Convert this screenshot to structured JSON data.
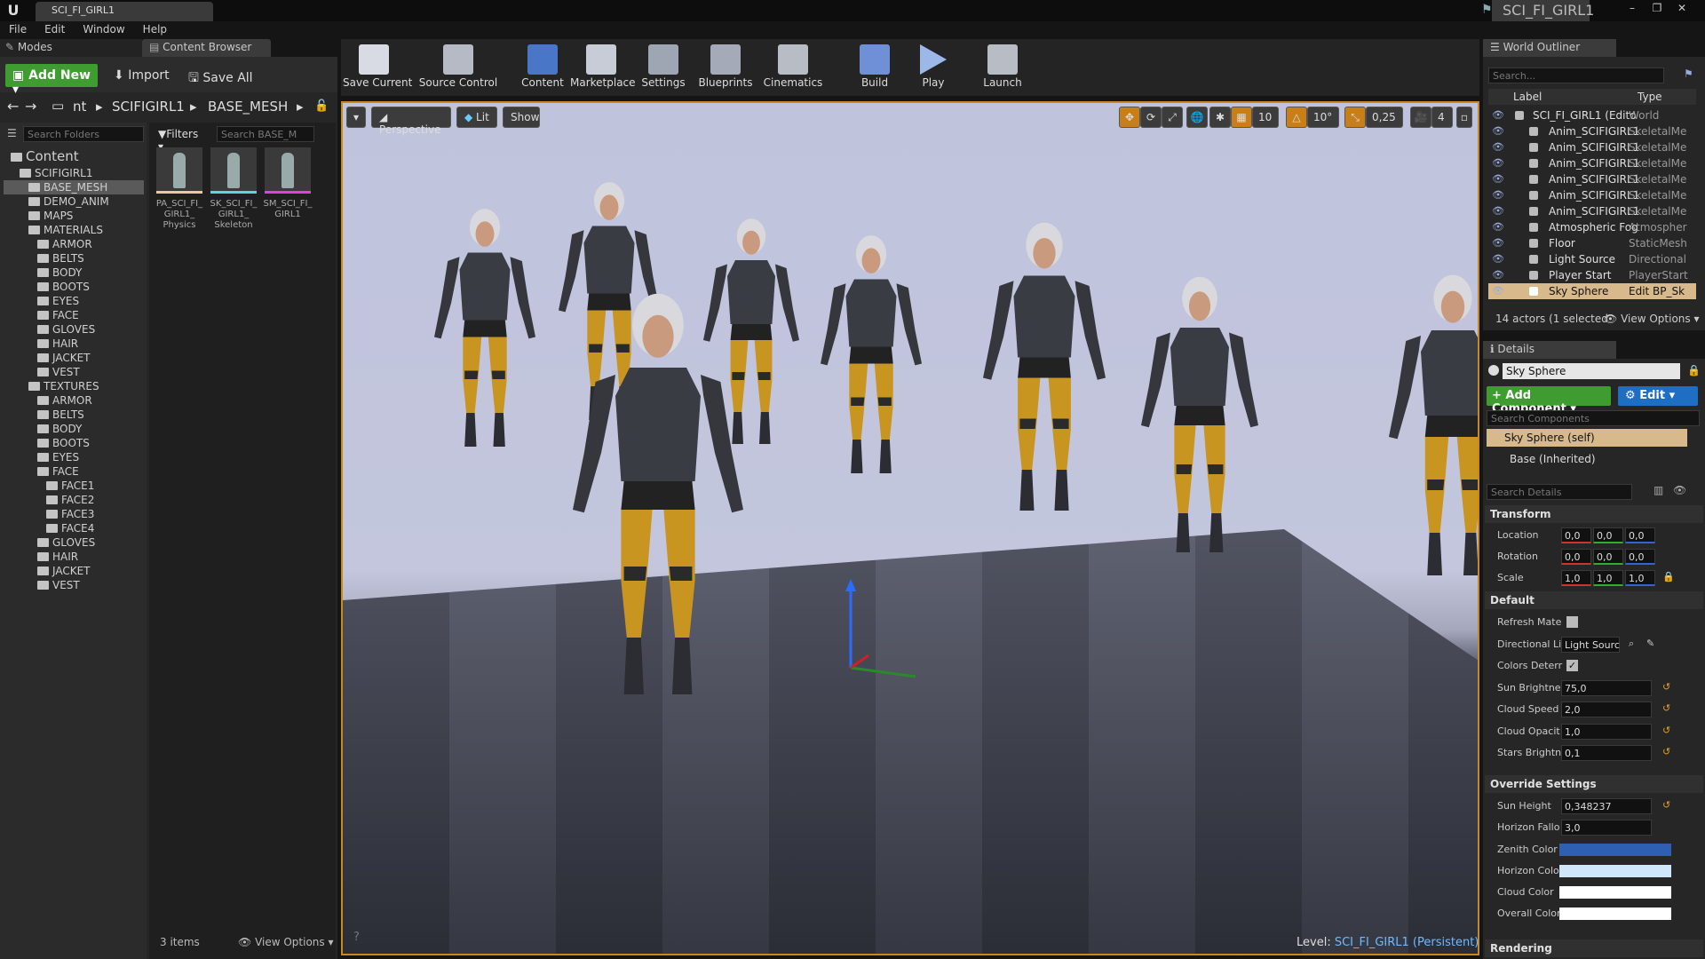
{
  "window": {
    "tab": "SCI_FI_GIRL1",
    "title": "SCI_FI_GIRL1"
  },
  "menu": [
    "File",
    "Edit",
    "Window",
    "Help"
  ],
  "panels": {
    "modes": "Modes",
    "content_browser": "Content Browser",
    "world_outliner": "World Outliner",
    "details": "Details"
  },
  "cb": {
    "add_new": "Add New",
    "import": "Import",
    "save_all": "Save All",
    "path": [
      "nt",
      "SCIFIGIRL1",
      "BASE_MESH"
    ],
    "folder_search": "Search Folders",
    "filters": "Filters",
    "asset_search": "Search BASE_M",
    "tree": [
      {
        "label": "Content",
        "depth": 0
      },
      {
        "label": "SCIFIGIRL1",
        "depth": 1
      },
      {
        "label": "BASE_MESH",
        "depth": 2,
        "selected": true
      },
      {
        "label": "DEMO_ANIM",
        "depth": 2
      },
      {
        "label": "MAPS",
        "depth": 2
      },
      {
        "label": "MATERIALS",
        "depth": 2
      },
      {
        "label": "ARMOR",
        "depth": 3
      },
      {
        "label": "BELTS",
        "depth": 3
      },
      {
        "label": "BODY",
        "depth": 3
      },
      {
        "label": "BOOTS",
        "depth": 3
      },
      {
        "label": "EYES",
        "depth": 3
      },
      {
        "label": "FACE",
        "depth": 3
      },
      {
        "label": "GLOVES",
        "depth": 3
      },
      {
        "label": "HAIR",
        "depth": 3
      },
      {
        "label": "JACKET",
        "depth": 3
      },
      {
        "label": "VEST",
        "depth": 3
      },
      {
        "label": "TEXTURES",
        "depth": 2
      },
      {
        "label": "ARMOR",
        "depth": 3
      },
      {
        "label": "BELTS",
        "depth": 3
      },
      {
        "label": "BODY",
        "depth": 3
      },
      {
        "label": "BOOTS",
        "depth": 3
      },
      {
        "label": "EYES",
        "depth": 3
      },
      {
        "label": "FACE",
        "depth": 3
      },
      {
        "label": "FACE1",
        "depth": 4
      },
      {
        "label": "FACE2",
        "depth": 4
      },
      {
        "label": "FACE3",
        "depth": 4
      },
      {
        "label": "FACE4",
        "depth": 4
      },
      {
        "label": "GLOVES",
        "depth": 3
      },
      {
        "label": "HAIR",
        "depth": 3
      },
      {
        "label": "JACKET",
        "depth": 3
      },
      {
        "label": "VEST",
        "depth": 3
      }
    ],
    "assets": [
      {
        "line1": "PA_SCI_FI_",
        "line2": "GIRL1_",
        "line3": "Physics",
        "color": "#e8c9a0"
      },
      {
        "line1": "SK_SCI_FI_",
        "line2": "GIRL1_",
        "line3": "Skeleton",
        "color": "#5fd3e0"
      },
      {
        "line1": "SM_SCI_FI_",
        "line2": "GIRL1",
        "line3": "",
        "color": "#e040e0"
      }
    ],
    "items_count": "3 items",
    "view_options": "View Options"
  },
  "toolbar": [
    {
      "label": "Save Current",
      "icon": "save-icon"
    },
    {
      "label": "Source Control",
      "icon": "source-control-icon"
    },
    {
      "label": "Content",
      "icon": "content-icon"
    },
    {
      "label": "Marketplace",
      "icon": "marketplace-icon"
    },
    {
      "label": "Settings",
      "icon": "settings-icon"
    },
    {
      "label": "Blueprints",
      "icon": "blueprints-icon"
    },
    {
      "label": "Cinematics",
      "icon": "cinematics-icon"
    },
    {
      "label": "Build",
      "icon": "build-icon"
    },
    {
      "label": "Play",
      "icon": "play-icon"
    },
    {
      "label": "Launch",
      "icon": "launch-icon"
    }
  ],
  "viewport": {
    "perspective": "Perspective",
    "lit": "Lit",
    "show": "Show",
    "grid_snap": "10",
    "rot_snap": "10°",
    "scale_snap": "0,25",
    "cam_speed": "4",
    "level_label": "Level:",
    "level_name": "SCI_FI_GIRL1 (Persistent)"
  },
  "outliner": {
    "search": "Search...",
    "col_label": "Label",
    "col_type": "Type",
    "rows": [
      {
        "label": "SCI_FI_GIRL1 (Edito",
        "type": "World"
      },
      {
        "label": "Anim_SCIFIGIRL1",
        "type": "SkeletalMe"
      },
      {
        "label": "Anim_SCIFIGIRL1",
        "type": "SkeletalMe"
      },
      {
        "label": "Anim_SCIFIGIRL1",
        "type": "SkeletalMe"
      },
      {
        "label": "Anim_SCIFIGIRL1",
        "type": "SkeletalMe"
      },
      {
        "label": "Anim_SCIFIGIRL1",
        "type": "SkeletalMe"
      },
      {
        "label": "Anim_SCIFIGIRL1",
        "type": "SkeletalMe"
      },
      {
        "label": "Atmospheric Fog",
        "type": "Atmospher"
      },
      {
        "label": "Floor",
        "type": "StaticMesh"
      },
      {
        "label": "Light Source",
        "type": "Directional"
      },
      {
        "label": "Player Start",
        "type": "PlayerStart"
      },
      {
        "label": "Sky Sphere",
        "type": "Edit BP_Sk",
        "selected": true
      }
    ],
    "status": "14 actors (1 selected",
    "view_options": "View Options"
  },
  "details": {
    "name": "Sky Sphere",
    "add_component": "+ Add Component",
    "edit_bp": "Edit",
    "search_components": "Search Components",
    "self": "Sky Sphere (self)",
    "base": "Base (Inherited)",
    "search_details": "Search Details",
    "transform": "Transform",
    "location": {
      "label": "Location",
      "x": "0,0",
      "y": "0,0",
      "z": "0,0"
    },
    "rotation": {
      "label": "Rotation",
      "x": "0,0",
      "y": "0,0",
      "z": "0,0"
    },
    "scale": {
      "label": "Scale",
      "x": "1,0",
      "y": "1,0",
      "z": "1,0"
    },
    "default": "Default",
    "props": [
      {
        "label": "Refresh Mate",
        "kind": "check",
        "checked": false
      },
      {
        "label": "Directional Li",
        "kind": "select",
        "value": "Light Sourc"
      },
      {
        "label": "Colors Deterr",
        "kind": "check",
        "checked": true
      },
      {
        "label": "Sun Brightne",
        "kind": "num",
        "value": "75,0"
      },
      {
        "label": "Cloud Speed",
        "kind": "num",
        "value": "2,0"
      },
      {
        "label": "Cloud Opacit",
        "kind": "num",
        "value": "1,0"
      },
      {
        "label": "Stars Brightn",
        "kind": "num",
        "value": "0,1"
      }
    ],
    "override": "Override Settings",
    "override_props": [
      {
        "label": "Sun Height",
        "value": "0,348237"
      },
      {
        "label": "Horizon Fallo",
        "value": "3,0"
      }
    ],
    "colors": [
      {
        "label": "Zenith Color",
        "color": "#2f5fb0"
      },
      {
        "label": "Horizon Colo",
        "color": "#cfe6fb"
      },
      {
        "label": "Cloud Color",
        "color": "#ffffff"
      },
      {
        "label": "Overall Color",
        "color": "#ffffff"
      }
    ],
    "rendering": "Rendering"
  }
}
